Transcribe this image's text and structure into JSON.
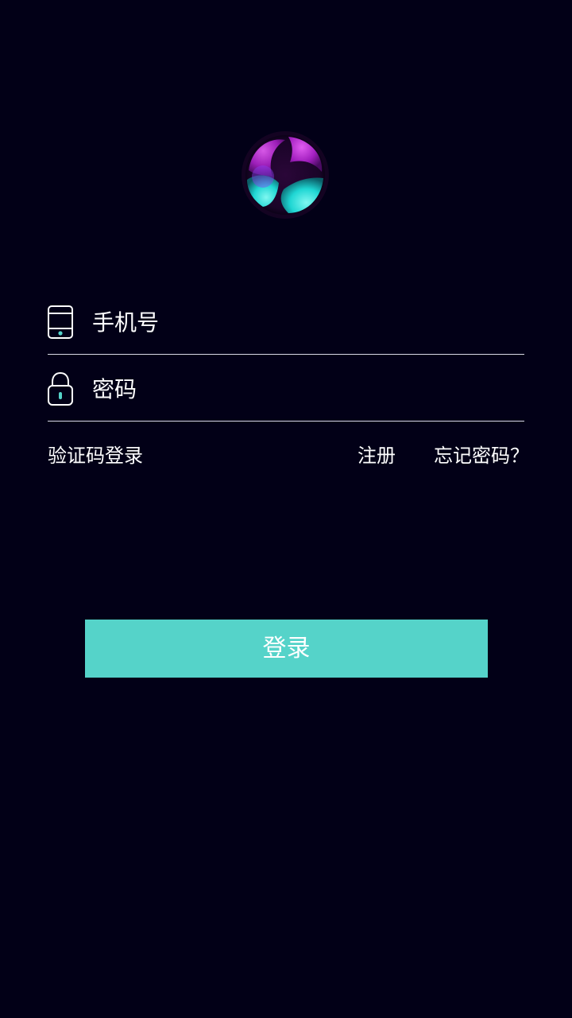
{
  "logo": {
    "icon": "app-logo-orb"
  },
  "form": {
    "phone": {
      "placeholder": "手机号",
      "value": "",
      "icon": "phone-icon"
    },
    "password": {
      "placeholder": "密码",
      "value": "",
      "icon": "lock-icon"
    }
  },
  "links": {
    "sms_login": "验证码登录",
    "register": "注册",
    "forgot_password": "忘记密码？"
  },
  "login_button": "登录",
  "colors": {
    "background": "#020017",
    "accent": "#55d3c9",
    "divider": "#d9d9e6",
    "logo_magenta": "#c02ad6",
    "logo_cyan": "#1fd6d3"
  }
}
